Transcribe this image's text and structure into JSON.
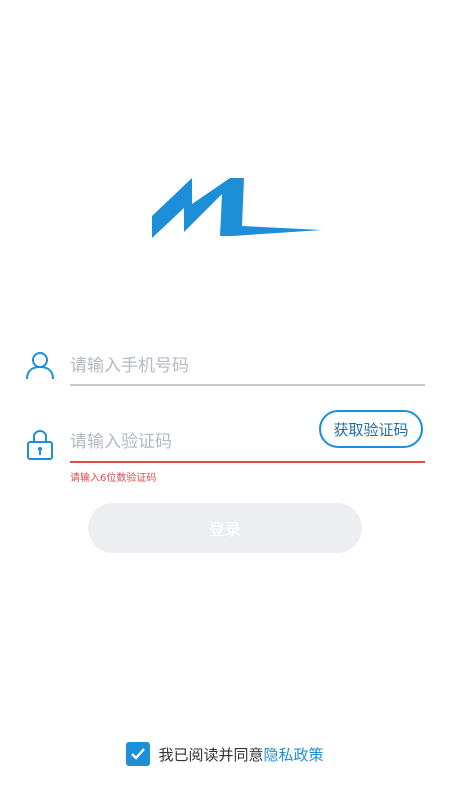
{
  "phone": {
    "placeholder": "请输入手机号码",
    "icon": "user-icon"
  },
  "code": {
    "placeholder": "请输入验证码",
    "icon": "lock-icon",
    "button_label": "获取验证码",
    "error": "请输入6位数验证码"
  },
  "login": {
    "label": "登录"
  },
  "agreement": {
    "text": "我已阅读并同意",
    "link": "隐私政策",
    "checked": true
  },
  "colors": {
    "brand": "#1d8ed8",
    "error": "#e34a4a",
    "disabled_button": "#eceef2"
  }
}
